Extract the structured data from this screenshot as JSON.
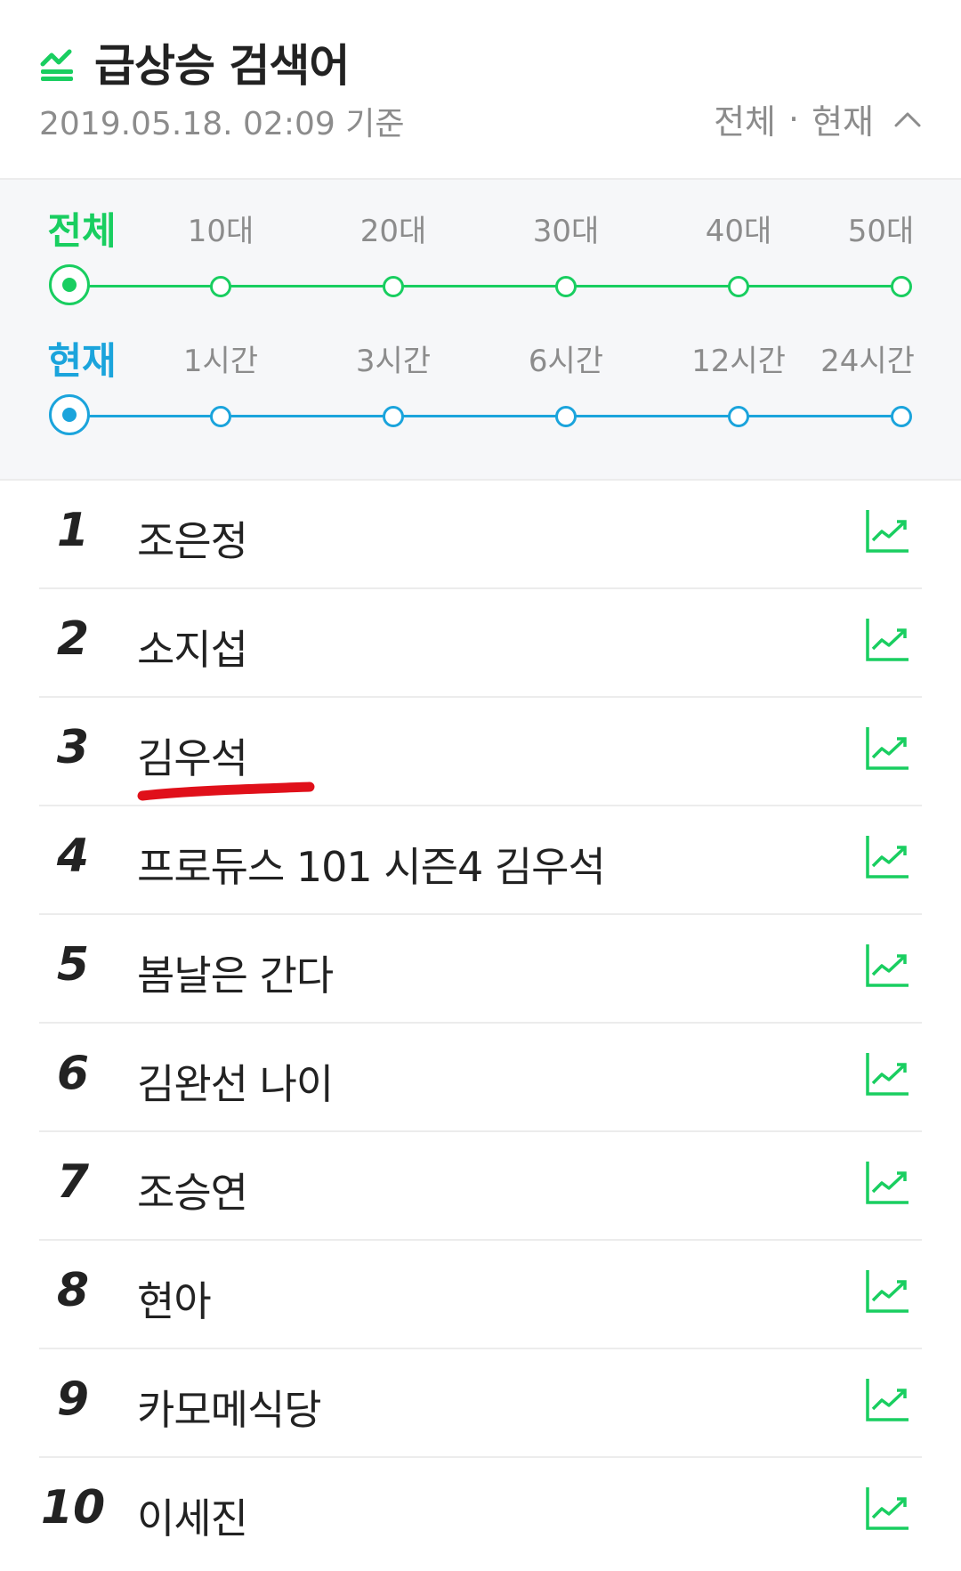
{
  "header": {
    "title": "급상승 검색어",
    "timestamp": "2019.05.18. 02:09 기준",
    "filter_age": "전체",
    "filter_separator": "·",
    "filter_time": "현재"
  },
  "filters": {
    "age_options": [
      "전체",
      "10대",
      "20대",
      "30대",
      "40대",
      "50대"
    ],
    "age_selected": "전체",
    "time_options": [
      "현재",
      "1시간",
      "3시간",
      "6시간",
      "12시간",
      "24시간"
    ],
    "time_selected": "현재"
  },
  "ranking": [
    {
      "rank": "1",
      "keyword": "조은정"
    },
    {
      "rank": "2",
      "keyword": "소지섭"
    },
    {
      "rank": "3",
      "keyword": "김우석"
    },
    {
      "rank": "4",
      "keyword": "프로듀스 101 시즌4 김우석"
    },
    {
      "rank": "5",
      "keyword": "봄날은 간다"
    },
    {
      "rank": "6",
      "keyword": "김완선 나이"
    },
    {
      "rank": "7",
      "keyword": "조승연"
    },
    {
      "rank": "8",
      "keyword": "현아"
    },
    {
      "rank": "9",
      "keyword": "카모메식당"
    },
    {
      "rank": "10",
      "keyword": "이세진"
    }
  ],
  "colors": {
    "accent_green": "#19ce60",
    "accent_blue": "#1ba4dc",
    "annotation_red": "#e0101a"
  },
  "icons": {
    "title": "rising-trend-icon",
    "summary": "chevron-up-icon",
    "row": "trend-chart-icon"
  }
}
